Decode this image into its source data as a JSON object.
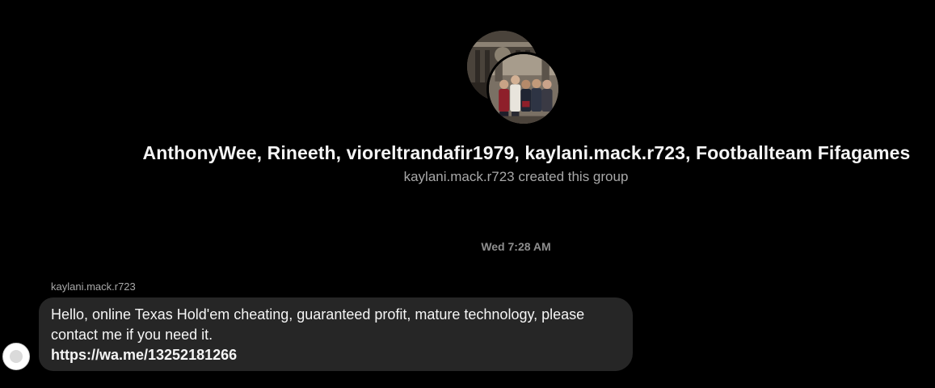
{
  "conversation": {
    "title": "AnthonyWee, Rineeth, vioreltrandafir1979, kaylani.mack.r723, Footballteam Fifagames",
    "subtitle": "kaylani.mack.r723 created this group",
    "timestamp": "Wed 7:28 AM"
  },
  "message": {
    "sender": "kaylani.mack.r723",
    "text": "Hello, online Texas Hold'em cheating, guaranteed profit, mature technology, please contact me if you need it.",
    "link": "https://wa.me/13252181266"
  },
  "colors": {
    "background": "#000000",
    "bubble": "#262626",
    "primary_text": "#f5f5f5",
    "secondary_text": "#a8a8a8",
    "timestamp_text": "#8e8e8e"
  },
  "icons": {
    "group_avatar": "group-avatar-photos",
    "sender_avatar": "default-profile-icon"
  }
}
